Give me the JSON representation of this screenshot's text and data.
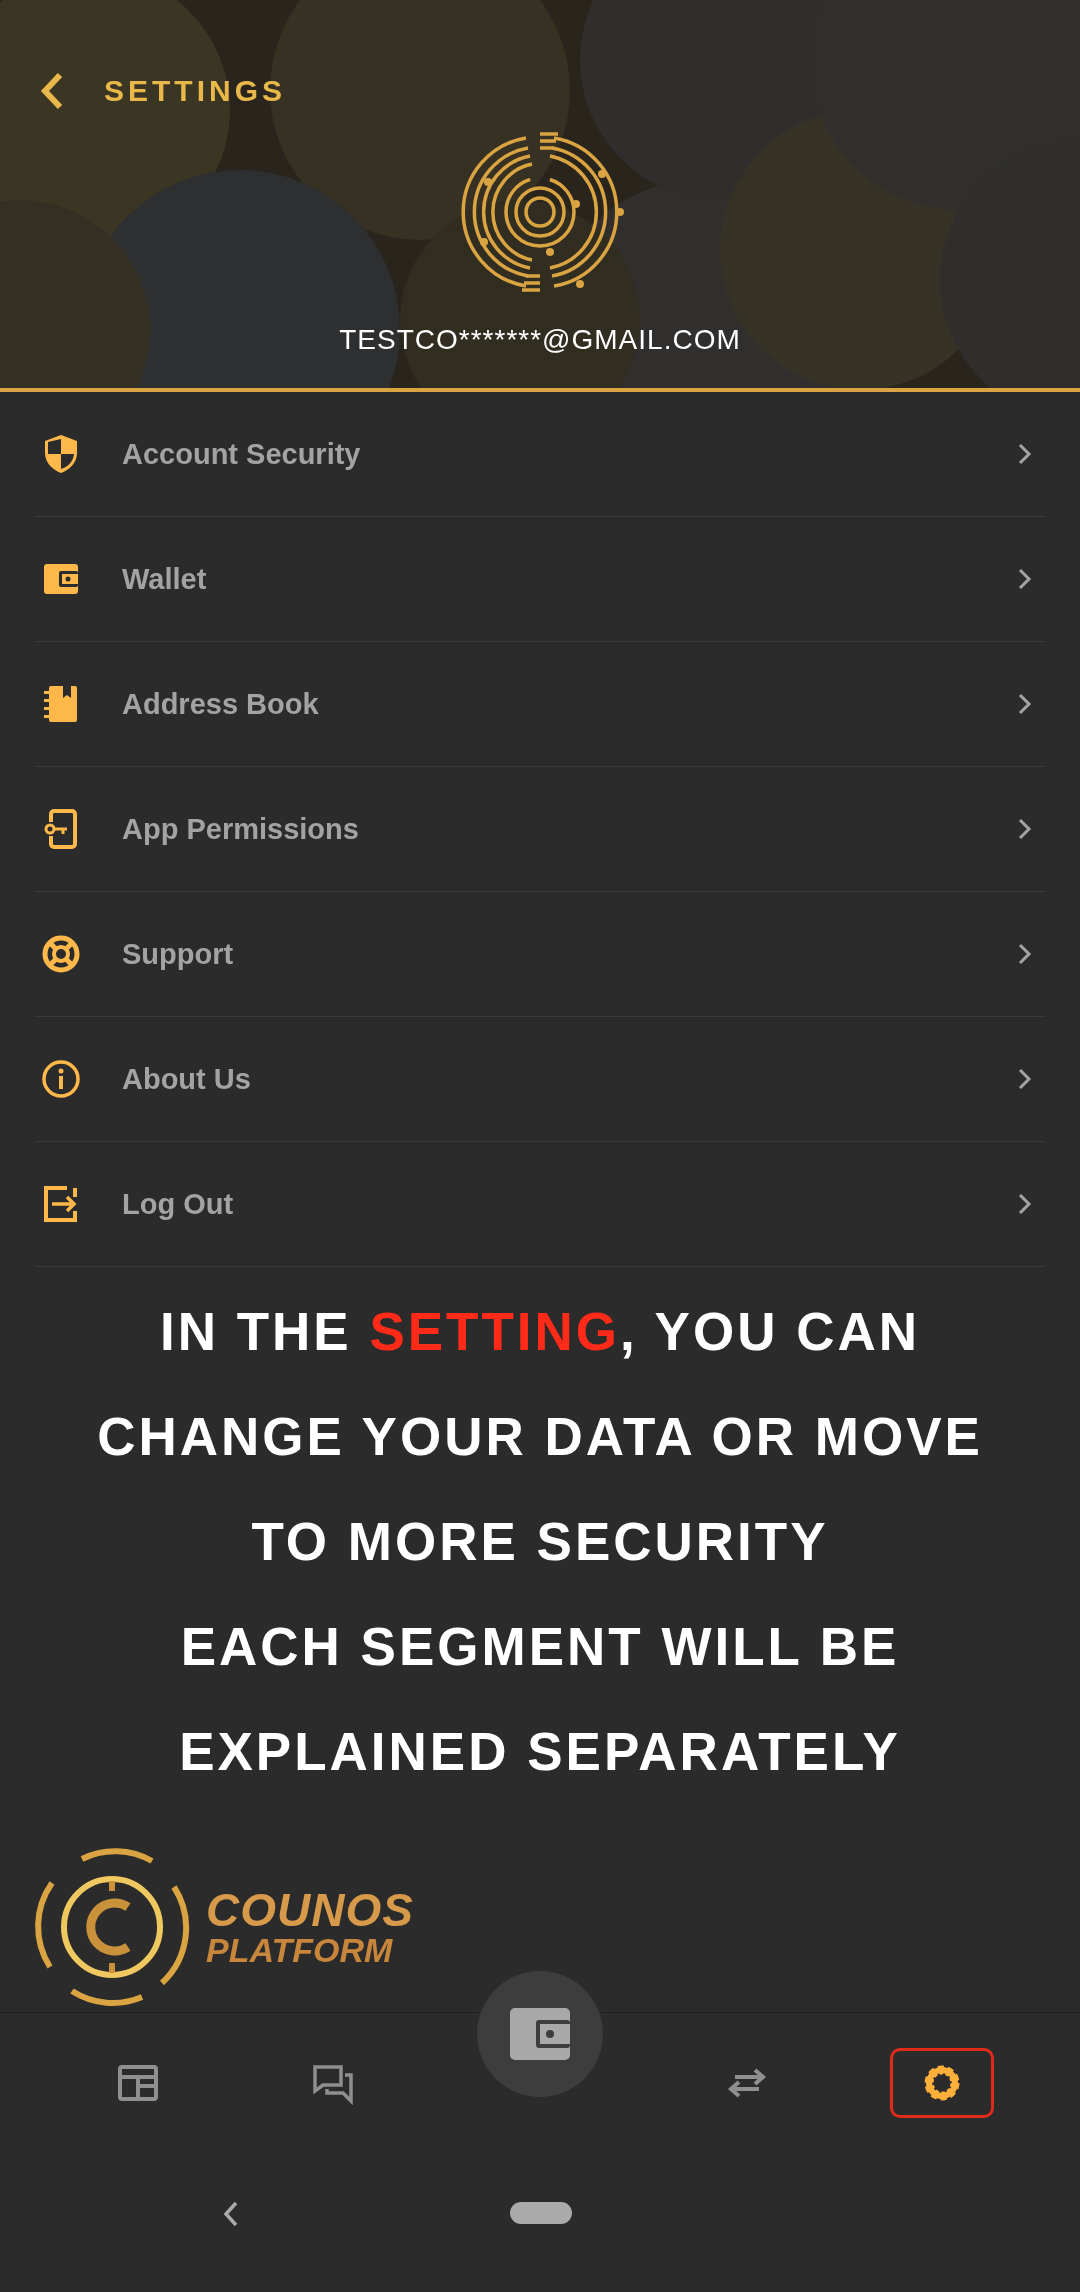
{
  "header": {
    "title": "SETTINGS",
    "email": "TESTCO*******@GMAIL.COM"
  },
  "menu": [
    {
      "kind": "shield",
      "label": "Account Security"
    },
    {
      "kind": "wallet",
      "label": "Wallet"
    },
    {
      "kind": "book",
      "label": "Address Book"
    },
    {
      "kind": "key",
      "label": "App Permissions"
    },
    {
      "kind": "lifebuoy",
      "label": "Support"
    },
    {
      "kind": "info",
      "label": "About Us"
    },
    {
      "kind": "logout",
      "label": "Log Out"
    }
  ],
  "caption": [
    {
      "runs": [
        {
          "text": "IN THE ",
          "highlighted": false
        },
        {
          "text": "SETTING",
          "highlighted": true
        },
        {
          "text": ", YOU CAN CHANGE YOUR DATA OR MOVE TO MORE SECURITY",
          "highlighted": false
        }
      ]
    },
    {
      "runs": [
        {
          "text": "EACH SEGMENT WILL BE EXPLAINED SEPARATELY",
          "highlighted": false
        }
      ]
    }
  ],
  "brand": {
    "line_1": "COUNOS",
    "line_2": "PLATFORM"
  },
  "bottom_nav": [
    {
      "kind": "news",
      "selected": false
    },
    {
      "kind": "chat",
      "selected": false
    },
    {
      "kind": "wallet",
      "selected": false
    },
    {
      "kind": "transfer",
      "selected": false
    },
    {
      "kind": "settings",
      "selected": true
    }
  ]
}
